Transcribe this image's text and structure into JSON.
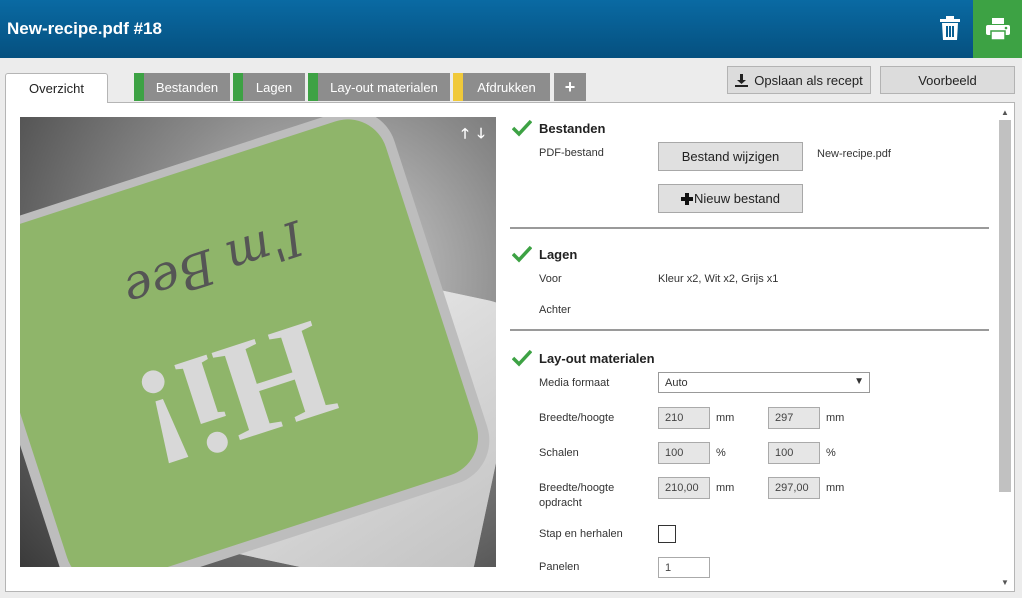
{
  "header": {
    "title": "New-recipe.pdf #18",
    "trash_icon": "trash-icon",
    "print_icon": "printer-icon"
  },
  "tabs": [
    {
      "label": "Overzicht",
      "active": true
    },
    {
      "label": "Bestanden",
      "marker_color": "#3da244"
    },
    {
      "label": "Lagen",
      "marker_color": "#3da244"
    },
    {
      "label": "Lay-out materialen",
      "marker_color": "#3da244"
    },
    {
      "label": "Afdrukken",
      "marker_color": "#f0c93a"
    },
    {
      "label": "+"
    }
  ],
  "toolbar": {
    "save_recipe": "Opslaan als recept",
    "preview": "Voorbeeld"
  },
  "preview": {
    "image": "Hi! I'm Bee label mockup",
    "arrow_up": "🡑",
    "arrow_down": "🡓"
  },
  "bestanden": {
    "title": "Bestanden",
    "pdf_label": "PDF-bestand",
    "change_button": "Bestand wijzigen",
    "filename": "New-recipe.pdf",
    "new_button": "Nieuw bestand"
  },
  "lagen": {
    "title": "Lagen",
    "front_label": "Voor",
    "front_value": "Kleur x2, Wit x2, Grijs x1",
    "back_label": "Achter"
  },
  "layout": {
    "title": "Lay-out materialen",
    "media_label": "Media formaat",
    "media_value": "Auto",
    "size_label": "Breedte/hoogte",
    "width": "210",
    "height": "297",
    "unit_mm": "mm",
    "scale_label": "Schalen",
    "scale_x": "100",
    "scale_y": "100",
    "unit_pct": "%",
    "job_size_label_1": "Breedte/hoogte",
    "job_size_label_2": "opdracht",
    "job_width": "210,00",
    "job_height": "297,00",
    "step_repeat_label": "Stap en herhalen",
    "panels_label": "Panelen",
    "panels_value": "1"
  }
}
